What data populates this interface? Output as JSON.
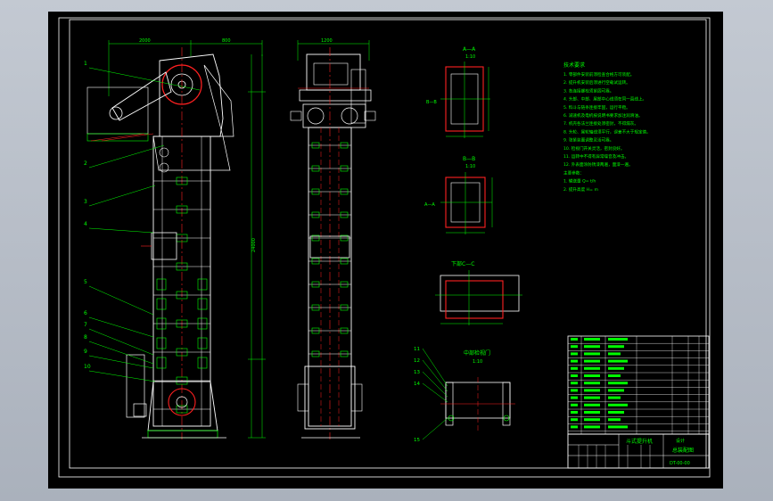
{
  "drawing": {
    "colors": {
      "background": "#000000",
      "border": "#ffffff",
      "geometry": "#ffffff",
      "annotation": "#00ff00",
      "centerline": "#ff2020",
      "section": "#ff2020",
      "text": "#00ff00"
    },
    "callouts": [
      "1",
      "2",
      "3",
      "4",
      "5",
      "6",
      "7",
      "8",
      "9",
      "10"
    ],
    "sections": {
      "a": {
        "title": "A—A",
        "scale": "1:10",
        "label": "B—B"
      },
      "b": {
        "title": "B—B",
        "scale": "1:10",
        "label": "A—A"
      },
      "c": {
        "title": "下部C—C"
      },
      "d": {
        "title": "中部检视门",
        "scale": "1:10"
      }
    },
    "detail_callouts": [
      "11",
      "12",
      "13",
      "14",
      "15"
    ],
    "notes": {
      "title": "技术要求",
      "lines": [
        "1. 零部件安装前须检查合格方可装配。",
        "2. 提升机安装后须进行空载试运转。",
        "3. 各连接螺栓须紧固可靠。",
        "4. 头部、中部、尾部中心线须在同一直线上。",
        "5. 料斗与链条连接牢固，运行平稳。",
        "6. 减速机及电机按说明书要求加注润滑油。",
        "7. 机壳各法兰连接处须密封，不得漏灰。",
        "8. 头轮、尾轮轴线须平行，误差不大于规定值。",
        "9. 张紧装置调整灵活可靠。",
        "10. 检视门开关灵活，密封良好。",
        "11. 运转中不得有异常噪音及冲击。",
        "12. 外表面涂防锈漆两遍，面漆一遍。",
        "主要参数：",
        "1. 输送量    Q=    t/h",
        "2. 提升高度  H=    m"
      ]
    },
    "title_block": {
      "drawing_title": "斗式提升机",
      "subtitle": "总装配图",
      "unit": "设计",
      "code": "DT-00-00"
    }
  }
}
